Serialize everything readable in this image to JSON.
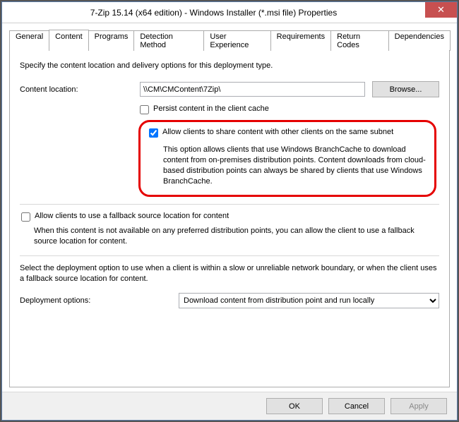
{
  "window": {
    "title": "7-Zip 15.14 (x64 edition) - Windows Installer (*.msi file) Properties"
  },
  "tabs": {
    "general": "General",
    "content": "Content",
    "programs": "Programs",
    "detection": "Detection Method",
    "userexp": "User Experience",
    "requirements": "Requirements",
    "returncodes": "Return Codes",
    "dependencies": "Dependencies"
  },
  "content": {
    "intro": "Specify the content location and delivery options for this deployment type.",
    "location_label": "Content location:",
    "location_value": "\\\\CM\\CMContent\\7Zip\\",
    "browse": "Browse...",
    "persist_label": "Persist content in the client cache",
    "share_label": "Allow clients to share content with other clients on the same subnet",
    "share_desc": "This option allows clients that use Windows BranchCache to download content from on-premises distribution points. Content downloads from cloud-based distribution points can always be shared by clients that use Windows BranchCache.",
    "fallback_label": "Allow clients to use a fallback source location for content",
    "fallback_desc": "When this content is not available on any preferred distribution points, you can allow the client to use a fallback source location for content.",
    "deploy_intro": "Select the deployment option to use when a client is within a slow or unreliable network boundary, or when the client uses a fallback source location for content.",
    "deploy_label": "Deployment options:",
    "deploy_value": "Download content from distribution point and run locally"
  },
  "footer": {
    "ok": "OK",
    "cancel": "Cancel",
    "apply": "Apply"
  }
}
